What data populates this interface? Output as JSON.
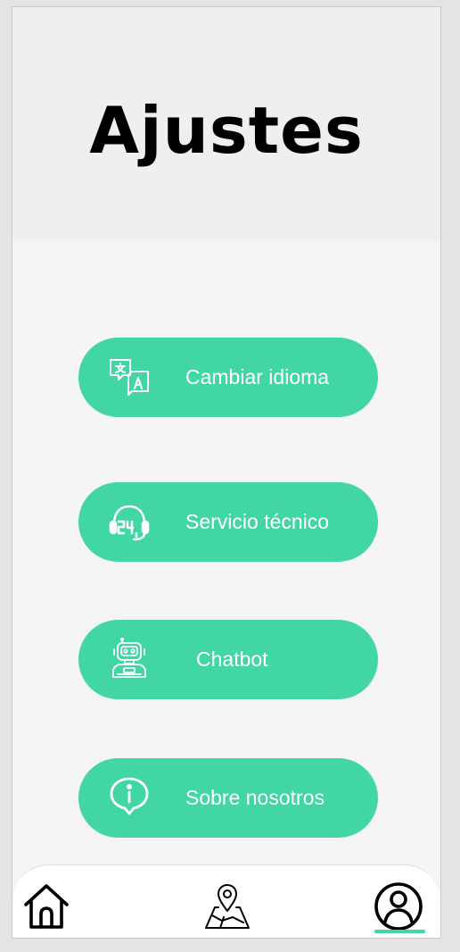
{
  "page": {
    "title": "Ajustes"
  },
  "menu": [
    {
      "label": "Cambiar idioma",
      "icon": "translate-icon"
    },
    {
      "label": "Servicio técnico",
      "icon": "support-24h-headset-icon"
    },
    {
      "label": "Chatbot",
      "icon": "robot-icon"
    },
    {
      "label": "Sobre nosotros",
      "icon": "info-icon"
    }
  ],
  "bottom_nav": {
    "items": [
      {
        "icon": "home-icon"
      },
      {
        "icon": "map-location-icon"
      },
      {
        "icon": "profile-icon",
        "active": true
      }
    ]
  },
  "colors": {
    "accent": "#42d6a4",
    "header_bg": "#efefef",
    "content_bg": "#f5f5f5",
    "title": "#000000"
  }
}
